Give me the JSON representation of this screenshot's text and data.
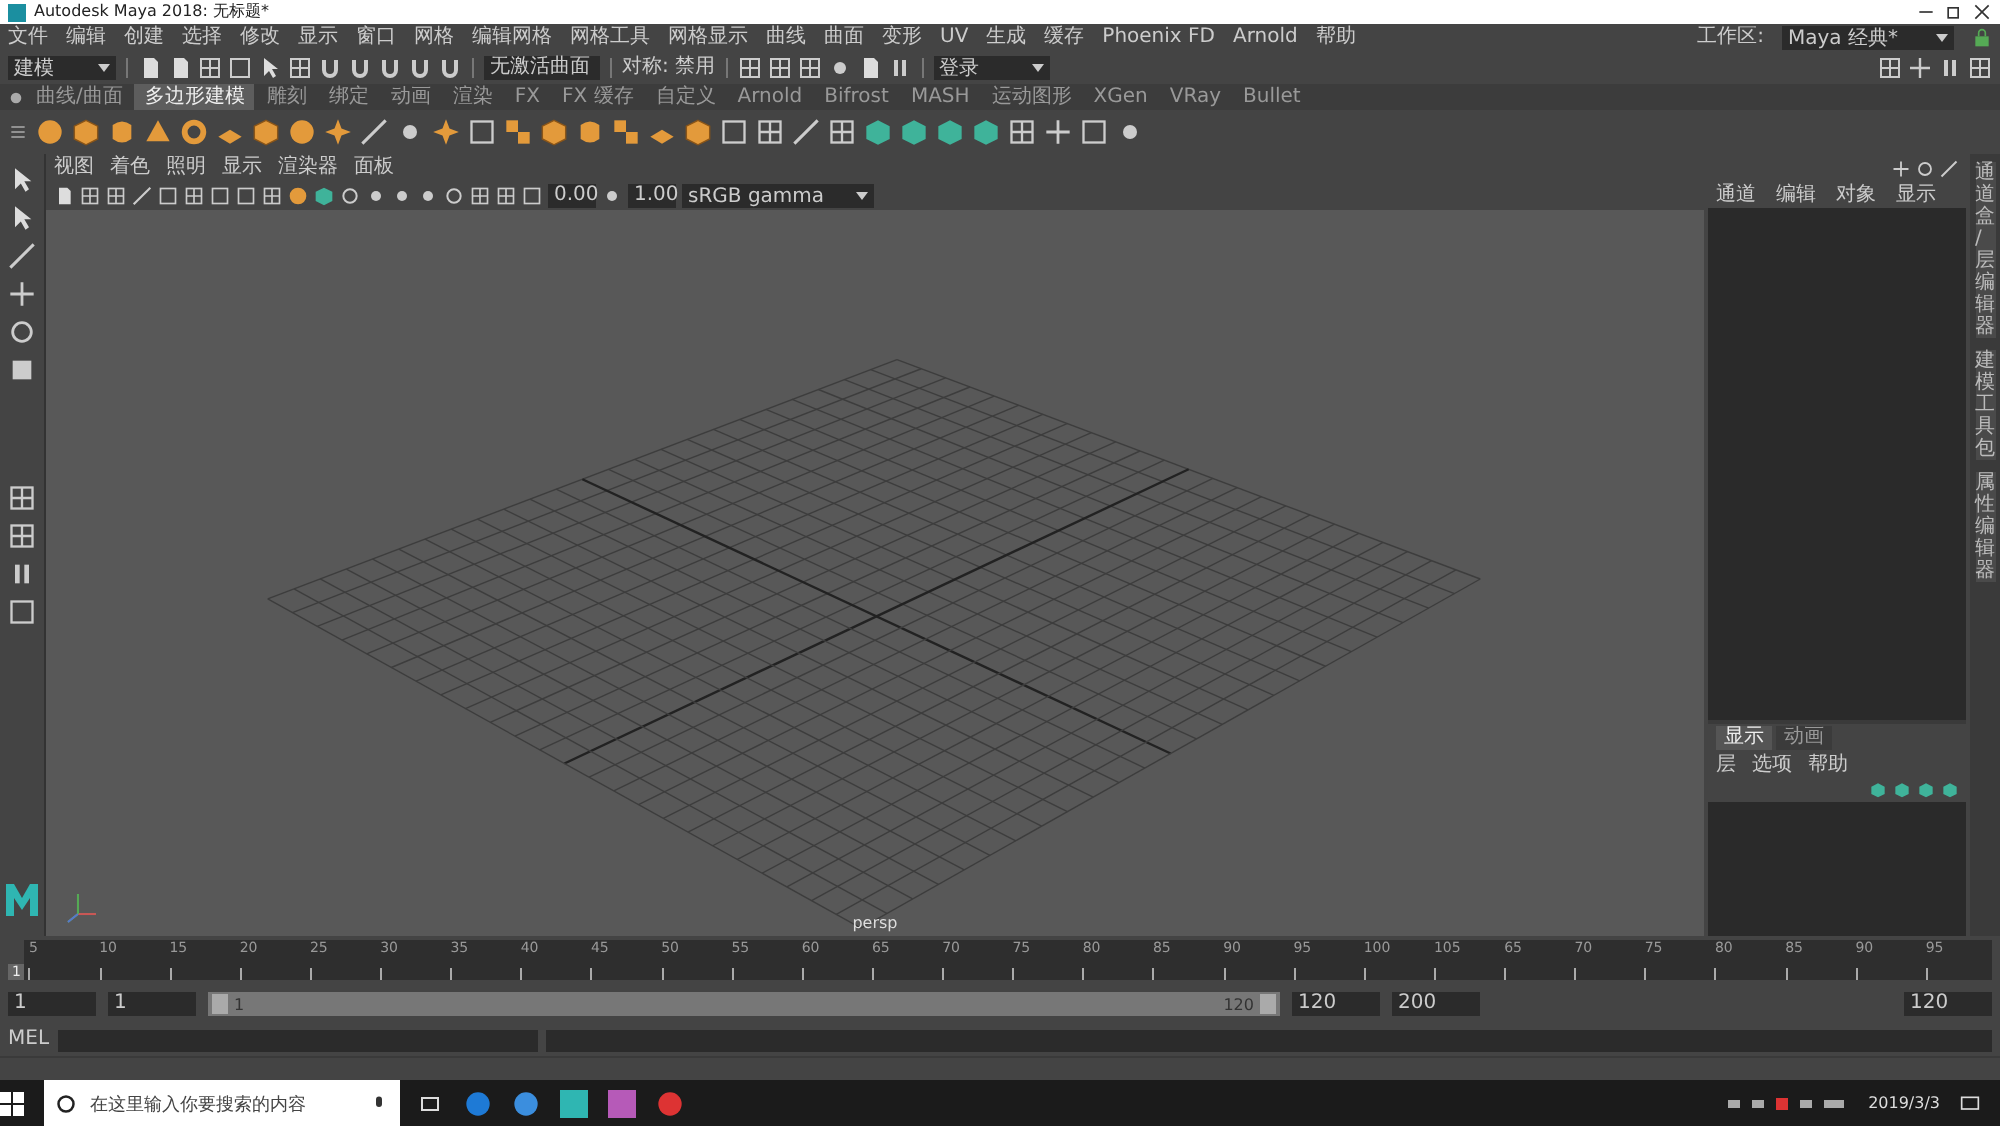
{
  "title_bar": {
    "title": "Autodesk Maya 2018: 无标题*"
  },
  "menu_bar": {
    "items": [
      "文件",
      "编辑",
      "创建",
      "选择",
      "修改",
      "显示",
      "窗口",
      "网格",
      "编辑网格",
      "网格工具",
      "网格显示",
      "曲线",
      "曲面",
      "变形",
      "UV",
      "生成",
      "缓存",
      "Phoenix FD",
      "Arnold",
      "帮助"
    ],
    "workspace_label": "工作区:",
    "workspace_value": "Maya 经典*"
  },
  "status_line": {
    "mode_menu": "建模",
    "surface_field": "无激活曲面",
    "symmetry": "对称: 禁用",
    "login": "登录"
  },
  "shelf": {
    "tabs": [
      {
        "label": "曲线/曲面",
        "selected": false
      },
      {
        "label": "多边形建模",
        "selected": true
      },
      {
        "label": "雕刻",
        "selected": false
      },
      {
        "label": "绑定",
        "selected": false
      },
      {
        "label": "动画",
        "selected": false
      },
      {
        "label": "渲染",
        "selected": false
      },
      {
        "label": "FX",
        "selected": false
      },
      {
        "label": "FX 缓存",
        "selected": false
      },
      {
        "label": "自定义",
        "selected": false
      },
      {
        "label": "Arnold",
        "selected": false
      },
      {
        "label": "Bifrost",
        "selected": false
      },
      {
        "label": "MASH",
        "selected": false
      },
      {
        "label": "运动图形",
        "selected": false
      },
      {
        "label": "XGen",
        "selected": false
      },
      {
        "label": "VRay",
        "selected": false
      },
      {
        "label": "Bullet",
        "selected": false
      }
    ]
  },
  "viewport": {
    "menus": [
      "视图",
      "着色",
      "照明",
      "显示",
      "渲染器",
      "面板"
    ],
    "exposure": "0.00",
    "gamma": "1.00",
    "color_space": "sRGB gamma",
    "camera": "persp"
  },
  "channel_box": {
    "menus": [
      "通道",
      "编辑",
      "对象",
      "显示"
    ]
  },
  "layer_editor": {
    "tabs": [
      {
        "label": "显示",
        "selected": true
      },
      {
        "label": "动画",
        "selected": false
      }
    ],
    "menus": [
      "层",
      "选项",
      "帮助"
    ]
  },
  "side_tabs": [
    "通道盒/层编辑器",
    "建模工具包",
    "属性编辑器"
  ],
  "time_slider": {
    "start_mark": "1",
    "ticks": [
      "5",
      "10",
      "15",
      "20",
      "25",
      "30",
      "35",
      "40",
      "45",
      "50",
      "55",
      "60",
      "65",
      "70",
      "75",
      "80",
      "85",
      "90",
      "95",
      "100",
      "105",
      "65",
      "70",
      "75",
      "80",
      "85",
      "90",
      "95"
    ]
  },
  "range_slider": {
    "level": 1,
    "start": "1",
    "playback_start": "1",
    "bar_start": "1",
    "bar_end": "120",
    "playback_end": "120",
    "end": "200",
    "current_frame": "120"
  },
  "command_line": {
    "language": "MEL"
  },
  "taskbar": {
    "search_placeholder": "在这里输入你要搜索的内容",
    "date": "2019/3/3"
  }
}
